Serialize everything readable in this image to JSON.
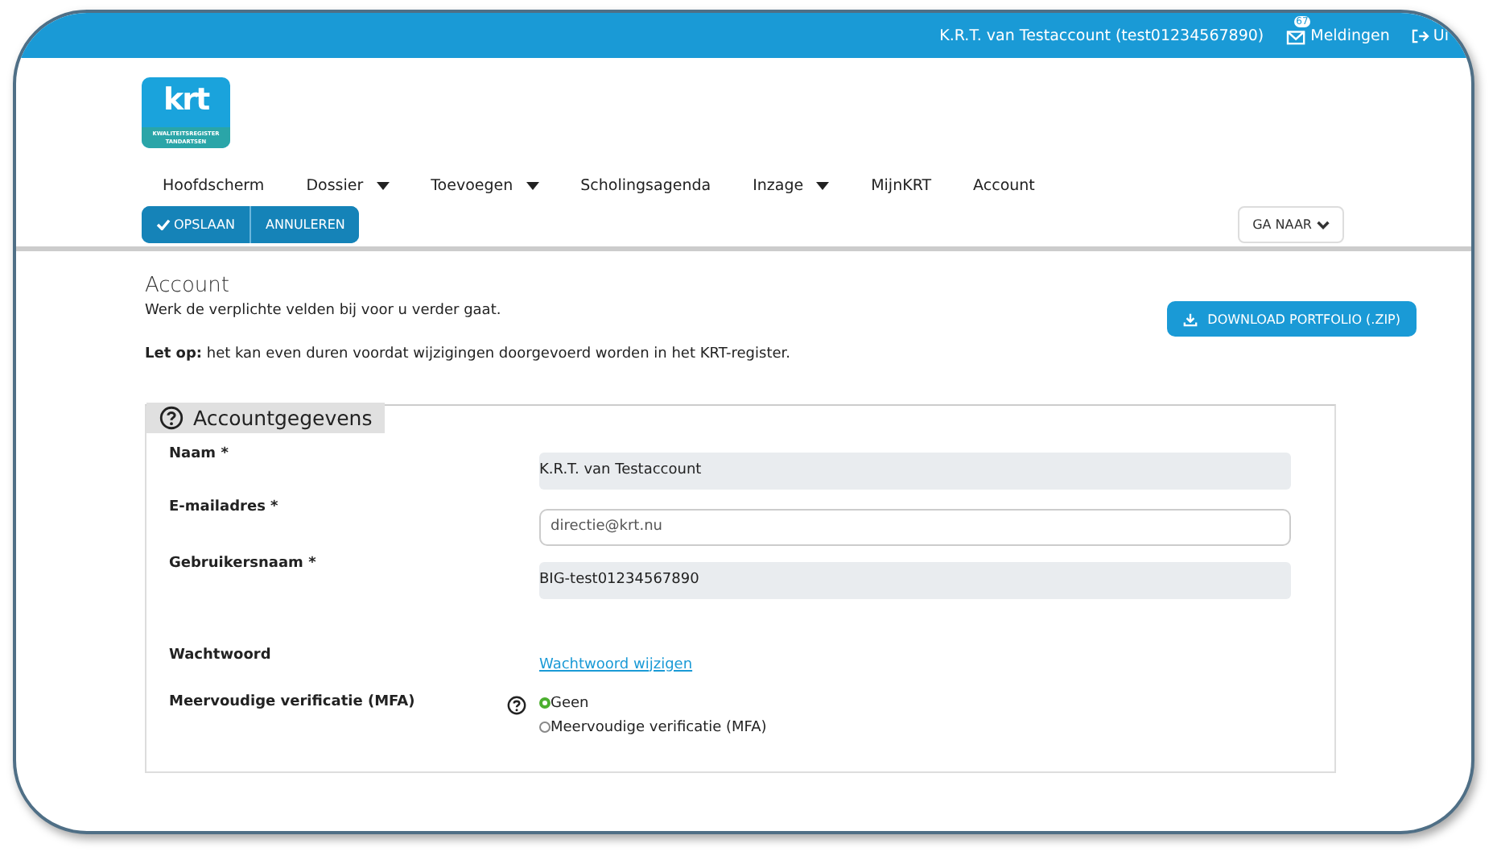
{
  "top_bar": {
    "user": "K.R.T. van Testaccount (test01234567890)",
    "notifications_count": "67",
    "notifications_label": "Meldingen",
    "logout_label": "Ui"
  },
  "logo": {
    "letters": "krt",
    "subtitle": "KWALITEITSREGISTER TANDARTSEN"
  },
  "nav": [
    {
      "label": "Hoofdscherm",
      "has_menu": false
    },
    {
      "label": "Dossier",
      "has_menu": true
    },
    {
      "label": "Toevoegen",
      "has_menu": true
    },
    {
      "label": "Scholingsagenda",
      "has_menu": false
    },
    {
      "label": "Inzage",
      "has_menu": true
    },
    {
      "label": "MijnKRT",
      "has_menu": false
    },
    {
      "label": "Account",
      "has_menu": false
    }
  ],
  "actions": {
    "save": "OPSLAAN",
    "cancel": "ANNULEREN",
    "goto": "GA NAAR"
  },
  "page": {
    "title": "Account",
    "intro": "Werk de verplichte velden bij voor u verder gaat.",
    "note": "**Let op:** het kan even duren voordat wijzigingen doorgevoerd worden in het KRT-register.",
    "download": "DOWNLOAD PORTFOLIO (.ZIP)"
  },
  "section": {
    "title": "Accountgegevens",
    "fields": [
      {
        "kind": "readonly",
        "label": "Naam *",
        "value": "K.R.T. van Testaccount"
      },
      {
        "kind": "input",
        "label": "E-mailadres *",
        "value": "directie@krt.nu"
      },
      {
        "kind": "readonly",
        "label": "Gebruikersnaam *",
        "value": "BIG-test01234567890"
      },
      {
        "kind": "link",
        "label": "Wachtwoord",
        "value": "Wachtwoord wijzigen"
      },
      {
        "kind": "radio",
        "label": "Meervoudige verificatie (MFA)",
        "help": true,
        "options": [
          {
            "label": "Geen",
            "selected": true
          },
          {
            "label": "Meervoudige verificatie (MFA)",
            "selected": false
          }
        ]
      }
    ]
  }
}
